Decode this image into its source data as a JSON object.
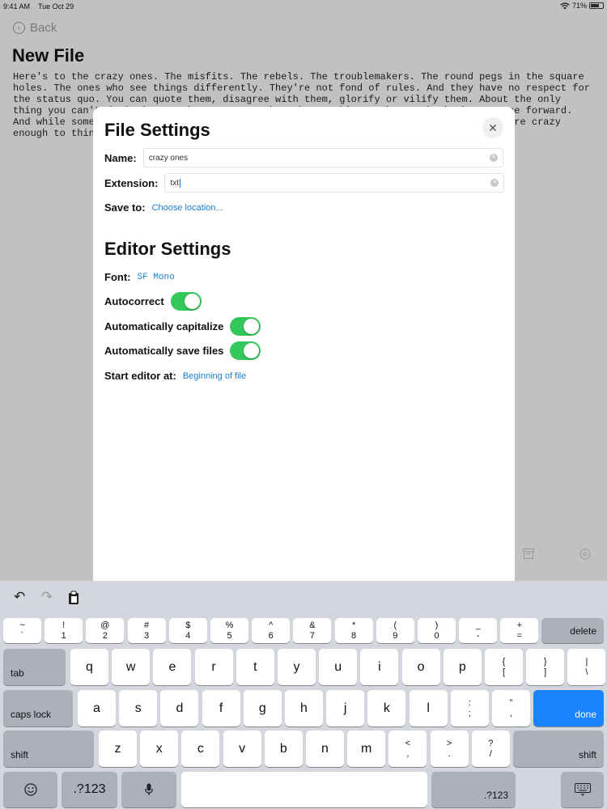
{
  "status_bar": {
    "time": "9:41 AM",
    "date": "Tue Oct 29",
    "battery_text": "71%",
    "battery_level": 0.71
  },
  "document": {
    "back_label": "Back",
    "title": "New File",
    "body": "Here's to the crazy ones. The misfits. The rebels. The troublemakers. The round pegs in the square holes. The ones who see things differently. They're not fond of rules. And they have no respect for the status quo. You can quote them, disagree with them, glorify or vilify them. About the only thing you can't do is ignore them. Because they change things. They push the human race forward. And while some may see them as the crazy ones, we see genius. Because the people who are crazy enough to think they can change the world, are the ones who do."
  },
  "modal": {
    "title": "File Settings",
    "name_label": "Name:",
    "name_value": "crazy ones",
    "extension_label": "Extension:",
    "extension_value": "txt",
    "save_to_label": "Save to:",
    "save_to_link": "Choose location...",
    "editor_title": "Editor Settings",
    "font_label": "Font:",
    "font_value": "SF Mono",
    "autocorrect_label": "Autocorrect",
    "autocorrect_on": true,
    "autocap_label": "Automatically capitalize",
    "autocap_on": true,
    "autosave_label": "Automatically save files",
    "autosave_on": true,
    "start_label": "Start editor at:",
    "start_value": "Beginning of file"
  },
  "keyboard": {
    "row1": [
      [
        "~",
        "`"
      ],
      [
        "!",
        "1"
      ],
      [
        "@",
        "2"
      ],
      [
        "#",
        "3"
      ],
      [
        "$",
        "4"
      ],
      [
        "%",
        "5"
      ],
      [
        "^",
        "6"
      ],
      [
        "&",
        "7"
      ],
      [
        "*",
        "8"
      ],
      [
        "(",
        "9"
      ],
      [
        ")",
        "0"
      ],
      [
        "_",
        "-"
      ],
      [
        "+",
        "="
      ]
    ],
    "row2": [
      [
        "",
        "q"
      ],
      [
        "",
        "w"
      ],
      [
        "",
        "e"
      ],
      [
        "",
        "r"
      ],
      [
        "",
        "t"
      ],
      [
        "",
        "y"
      ],
      [
        "",
        "u"
      ],
      [
        "",
        "i"
      ],
      [
        "",
        "o"
      ],
      [
        "",
        "p"
      ],
      [
        "{",
        "["
      ],
      [
        "}",
        "]"
      ],
      [
        "|",
        "\\"
      ]
    ],
    "row3": [
      [
        "",
        "a"
      ],
      [
        "",
        "s"
      ],
      [
        "",
        "d"
      ],
      [
        "",
        "f"
      ],
      [
        "",
        "g"
      ],
      [
        "",
        "h"
      ],
      [
        "",
        "j"
      ],
      [
        "",
        "k"
      ],
      [
        "",
        "l"
      ],
      [
        ":",
        ";"
      ],
      [
        "”",
        ","
      ]
    ],
    "row4": [
      [
        "",
        "z"
      ],
      [
        "",
        "x"
      ],
      [
        "",
        "c"
      ],
      [
        "",
        "v"
      ],
      [
        "",
        "b"
      ],
      [
        "",
        "n"
      ],
      [
        "",
        "m"
      ],
      [
        "<",
        ","
      ],
      [
        ">",
        "."
      ],
      [
        "?",
        "/"
      ]
    ],
    "delete": "delete",
    "tab": "tab",
    "caps_lock": "caps lock",
    "done": "done",
    "shift": "shift",
    "numbers": ".?123"
  }
}
